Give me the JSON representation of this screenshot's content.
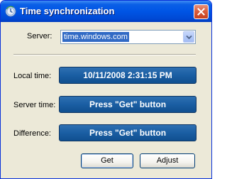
{
  "window": {
    "title": "Time synchronization",
    "title_icon": "clock-sync-icon",
    "close_icon": "close-icon"
  },
  "server": {
    "label": "Server:",
    "value": "time.windows.com",
    "dropdown_icon": "chevron-down-icon"
  },
  "local_time": {
    "label": "Local time:",
    "value": "10/11/2008 2:31:15 PM"
  },
  "server_time": {
    "label": "Server time:",
    "value": "Press \"Get\" button"
  },
  "difference": {
    "label": "Difference:",
    "value": "Press \"Get\" button"
  },
  "buttons": {
    "get_label": "Get",
    "adjust_label": "Adjust"
  },
  "colors": {
    "titlebar": "#0055e5",
    "display_background": "#1a5ea3",
    "display_text": "#ffffff",
    "dialog_background": "#ece9d8",
    "selection": "#316ac5",
    "close_button": "#d95d3d"
  }
}
